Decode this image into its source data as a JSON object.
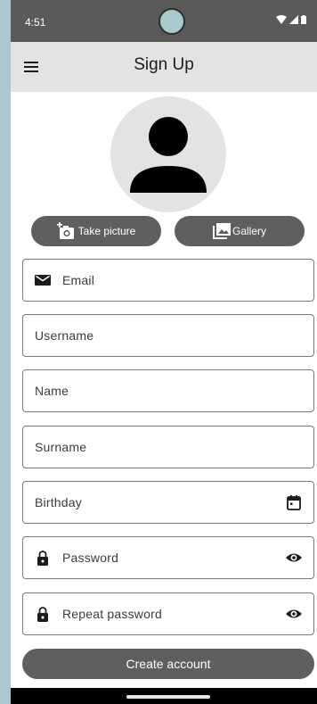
{
  "status_bar": {
    "time": "4:51",
    "icons": [
      "wifi-icon",
      "cellular-icon",
      "battery-icon"
    ]
  },
  "app_bar": {
    "title": "Sign Up",
    "menu_icon": "hamburger-menu-icon"
  },
  "profile": {
    "avatar_icon": "person-icon",
    "take_picture_label": "Take picture",
    "take_picture_icon": "add-camera-icon",
    "gallery_label": "Gallery",
    "gallery_icon": "image-icon"
  },
  "form": {
    "email": {
      "label": "Email",
      "icon": "mail-icon"
    },
    "username": {
      "label": "Username"
    },
    "name": {
      "label": "Name"
    },
    "surname": {
      "label": "Surname"
    },
    "birthday": {
      "label": "Birthday",
      "icon": "calendar-icon"
    },
    "password": {
      "label": "Password",
      "icon": "lock-icon",
      "toggle_icon": "eye-icon"
    },
    "repeat_password": {
      "label": "Repeat password",
      "icon": "lock-icon",
      "toggle_icon": "eye-icon"
    }
  },
  "create_account_label": "Create account",
  "colors": {
    "status_bar": "#5a5a5a",
    "app_bar": "#e3e3e3",
    "button": "#5f5f5f",
    "background": "#a9c9cf"
  }
}
